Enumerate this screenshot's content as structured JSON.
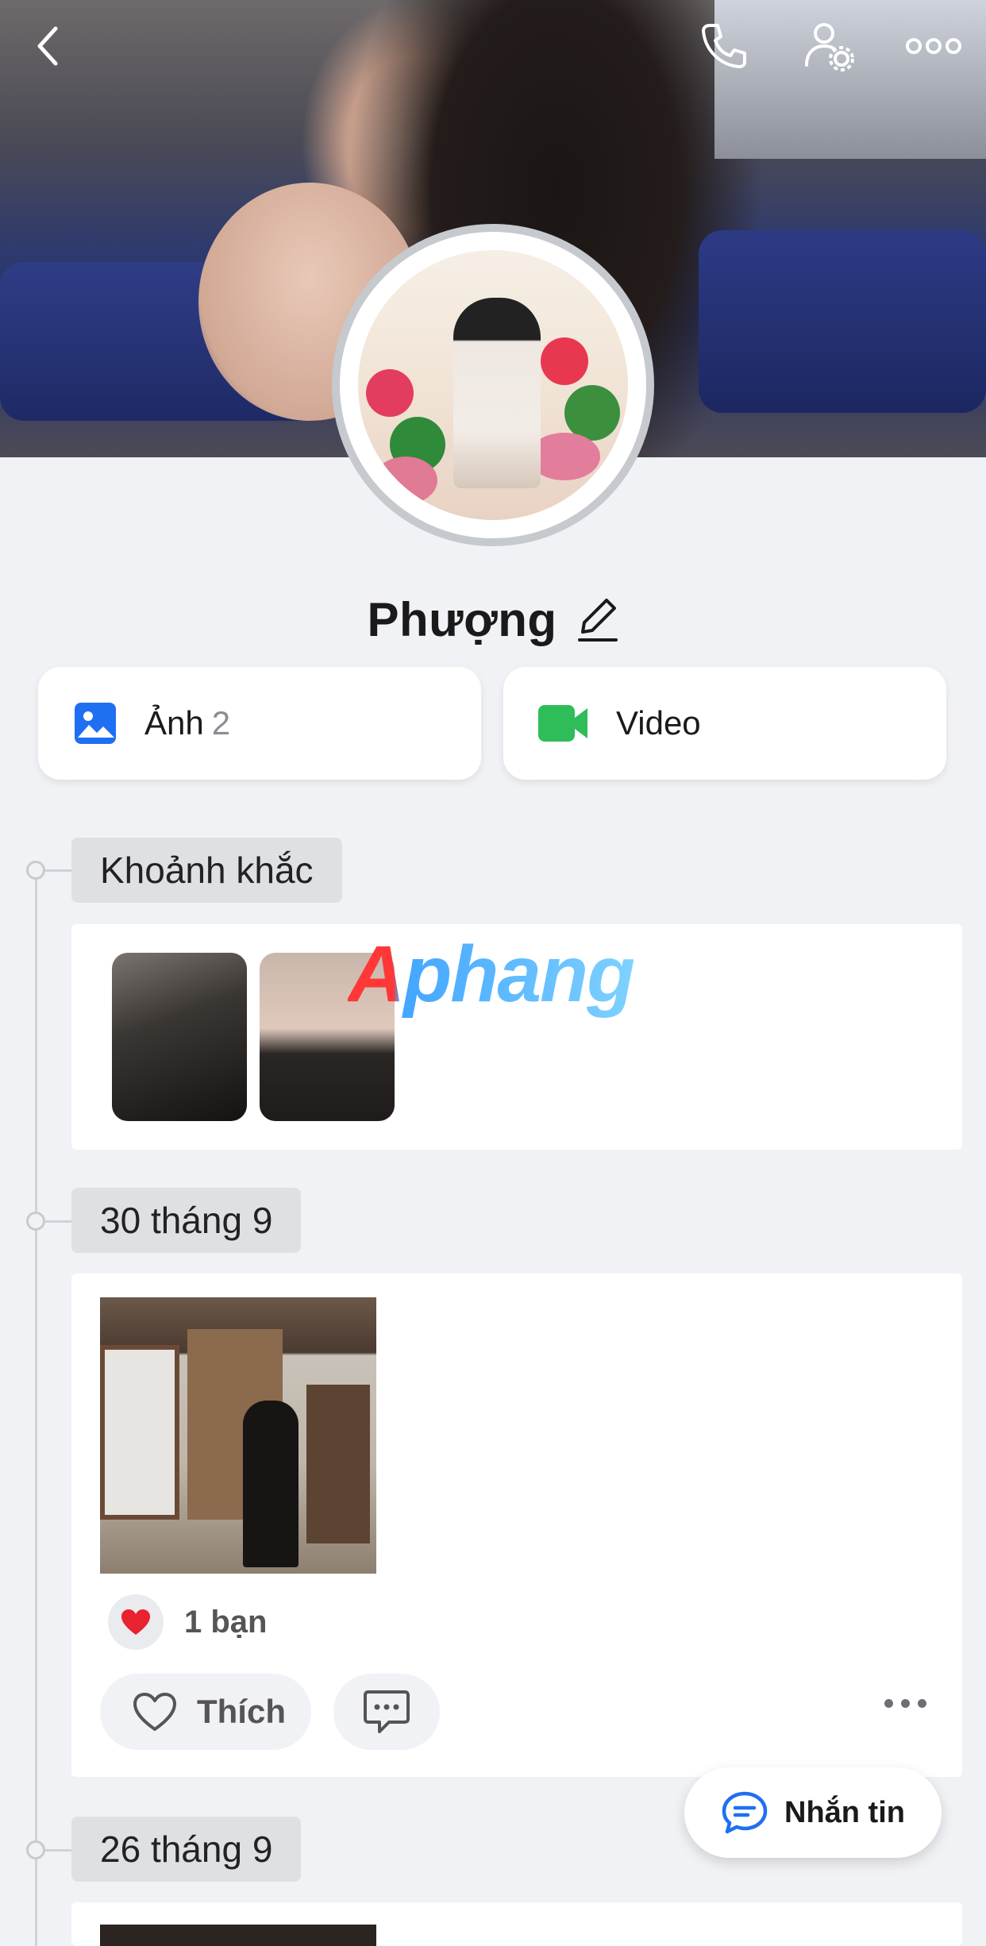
{
  "profile": {
    "name": "Phượng"
  },
  "tiles": {
    "photos_label": "Ảnh",
    "photos_count": "2",
    "video_label": "Video"
  },
  "sections": {
    "moments": "Khoảnh khắc",
    "date1": "30 tháng 9",
    "date2": "26 tháng 9"
  },
  "watermark": "Aphang",
  "post": {
    "reaction_text": "1 bạn",
    "like_label": "Thích"
  },
  "fab": {
    "label": "Nhắn tin"
  },
  "colors": {
    "accent_blue": "#1f6ff2",
    "video_green": "#2ebd59",
    "heart_red": "#e8222f"
  },
  "icons": [
    "back-icon",
    "phone-icon",
    "user-settings-icon",
    "more-icon",
    "pencil-icon",
    "photo-icon",
    "video-icon",
    "heart-reaction-icon",
    "heart-outline-icon",
    "comment-icon",
    "chat-bubble-icon"
  ]
}
